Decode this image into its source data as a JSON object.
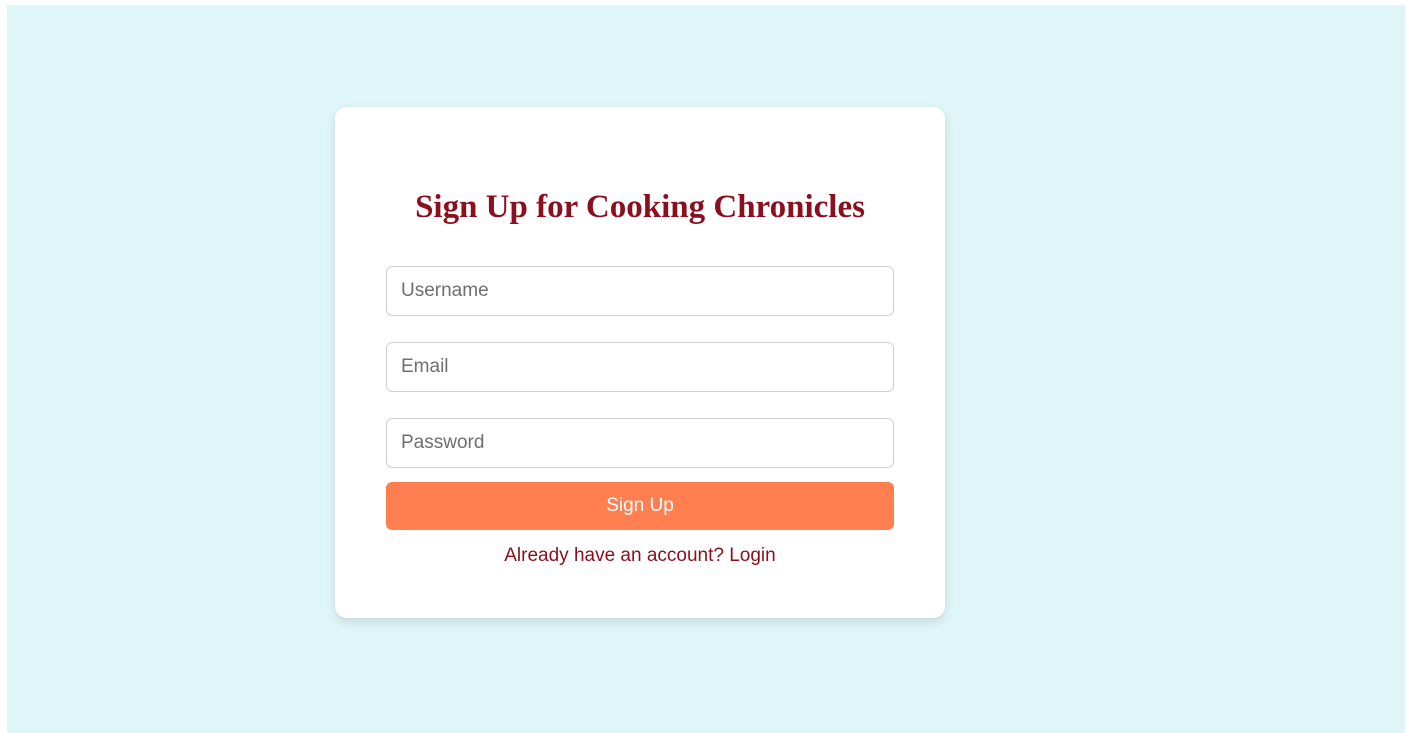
{
  "signup": {
    "title": "Sign Up for Cooking Chronicles",
    "username_placeholder": "Username",
    "email_placeholder": "Email",
    "password_placeholder": "Password",
    "submit_label": "Sign Up",
    "login_link": "Already have an account? Login"
  },
  "colors": {
    "background": "#dff6f8",
    "title": "#8b0f1e",
    "button": "#ff7f50",
    "link": "#8b0f1e"
  }
}
